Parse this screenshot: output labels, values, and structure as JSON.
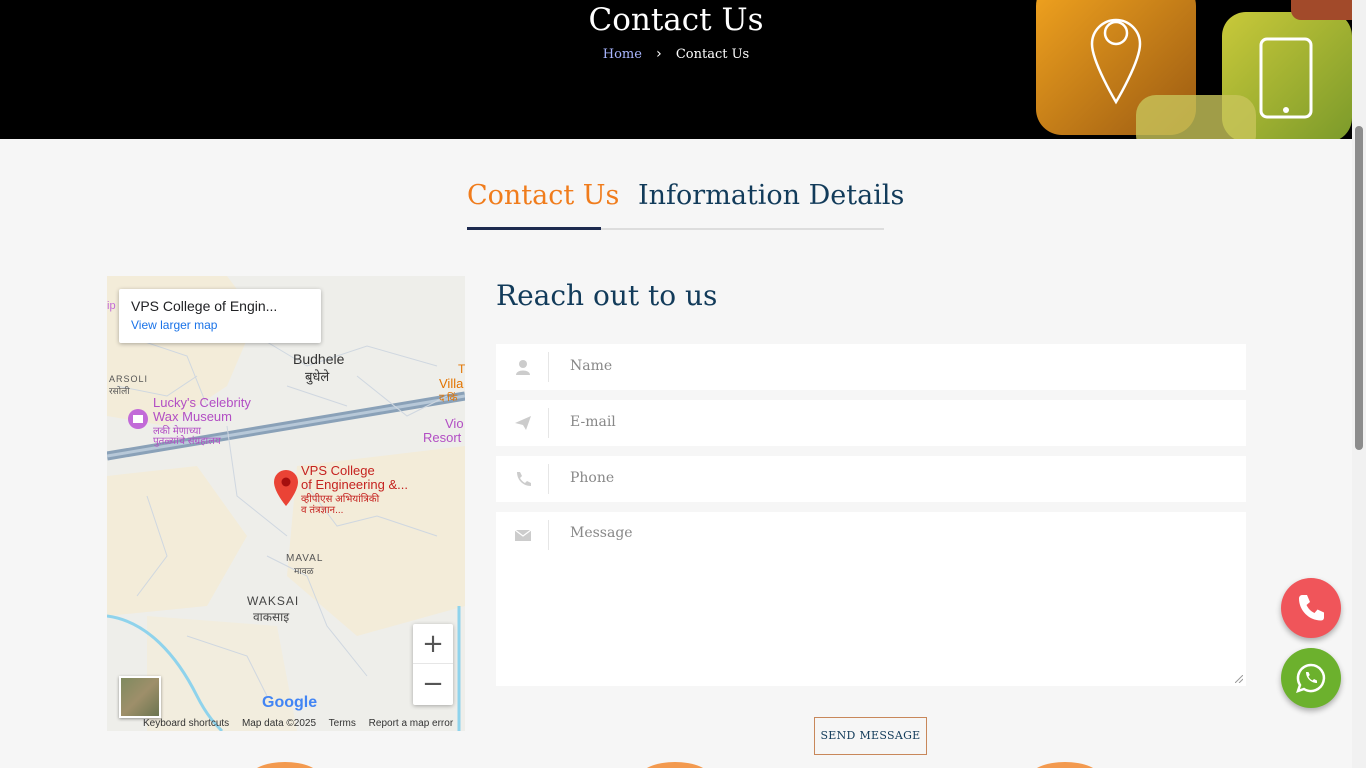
{
  "hero": {
    "title": "Contact Us",
    "breadcrumb_home": "Home",
    "breadcrumb_sep": "›",
    "breadcrumb_current": "Contact Us"
  },
  "tabs": [
    {
      "label": "Contact Us",
      "active": true
    },
    {
      "label": "Information Details",
      "active": false
    }
  ],
  "map": {
    "card_title": "VPS College of Engin...",
    "card_link": "View larger map",
    "labels": {
      "budhele": "Budhele",
      "budhele_mr": "बुधेले",
      "arsoli": "ARSOLI",
      "arsoli_mr": "रसोली",
      "museum": "Lucky's Celebrity",
      "museum2": "Wax Museum",
      "museum_mr": "लकी मेणाच्या",
      "museum_mr2": "पुतळ्यांचे संग्रहालय",
      "college1": "VPS College",
      "college2": "of Engineering &...",
      "college_mr1": "व्हीपीएस अभियांत्रिकी",
      "college_mr2": "व तंत्रज्ञान...",
      "maval": "MAVAL",
      "maval_mr": "मावळ",
      "waksai": "WAKSAI",
      "waksai_mr": "वाकसाइ",
      "villa": "Villa",
      "villa_mr": "द किं",
      "resort1": "Vio",
      "resort2": "Resort",
      "t": "T",
      "ip": "ip"
    },
    "zoom_in": "+",
    "zoom_out": "−",
    "google": "Google",
    "footer": [
      "Keyboard shortcuts",
      "Map data ©2025",
      "Terms",
      "Report a map error"
    ]
  },
  "form": {
    "heading": "Reach out to us",
    "name_placeholder": "Name",
    "email_placeholder": "E-mail",
    "phone_placeholder": "Phone",
    "message_placeholder": "Message",
    "submit": "SEND MESSAGE"
  },
  "colors": {
    "accent": "#f07c1c",
    "heading": "#123b5a",
    "phone_fab": "#f0555a",
    "whatsapp_fab": "#6cb12d"
  }
}
